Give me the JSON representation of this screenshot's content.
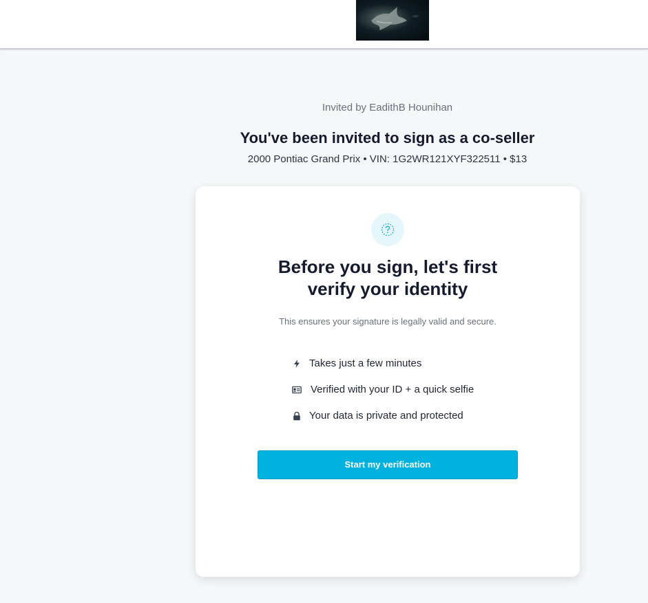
{
  "header": {
    "logo_icon": "shark-photo-logo"
  },
  "invitation": {
    "invited_by": "Invited by EadithB Hounihan",
    "headline": "You've been invited to sign as a co-seller",
    "vehicle_line": "2000 Pontiac Grand Prix • VIN: 1G2WR121XYF322511 • $13"
  },
  "card": {
    "badge_icon": "question-circle-icon",
    "title_line1": "Before you sign, let's first",
    "title_line2": "verify your identity",
    "subtitle": "This ensures your signature is legally valid and secure.",
    "features": [
      {
        "icon": "lightning-icon",
        "text": "Takes just a few minutes"
      },
      {
        "icon": "id-card-icon",
        "text": "Verified with your ID + a quick selfie"
      },
      {
        "icon": "lock-icon",
        "text": "Your data is private and protected"
      }
    ],
    "start_label": "Start my verification"
  },
  "colors": {
    "accent": "#00b2dd",
    "background": "#f5f7f9",
    "badge_bg": "#e6f7fb",
    "heading": "#151b2c",
    "muted": "#6b6f78"
  }
}
